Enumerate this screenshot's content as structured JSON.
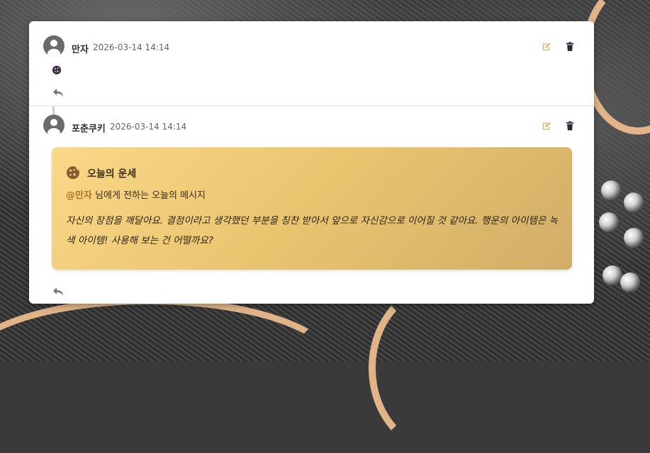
{
  "comments": [
    {
      "author": "만자",
      "time": "2026-03-14 14:14",
      "content_icon": "cookie-icon"
    },
    {
      "author": "포춘쿠키",
      "time": "2026-03-14 14:14",
      "fortune": {
        "icon": "cookie-icon",
        "title": "오늘의 운세",
        "mention": "@만자",
        "subtitle_suffix": " 님에게 전하는 오늘의 메시지",
        "message": "자신의 장점을 깨달아요. 결점이라고 생각했던 부분을 칭찬 받아서 앞으로 자신감으로 이어질 것 같아요. 행운의 아이템은 녹색 아이템! 사용해 보는 건 어떨까요?"
      }
    }
  ],
  "icons": {
    "edit": "edit-icon",
    "delete": "trash-icon",
    "reply": "reply-icon"
  },
  "colors": {
    "edit_icon": "#e8b070",
    "delete_icon": "#2b2b3b",
    "reply_icon": "#777777",
    "mention": "#b3722a",
    "fortune_gradient_start": "#fbd887",
    "fortune_gradient_end": "#d1ad68"
  }
}
